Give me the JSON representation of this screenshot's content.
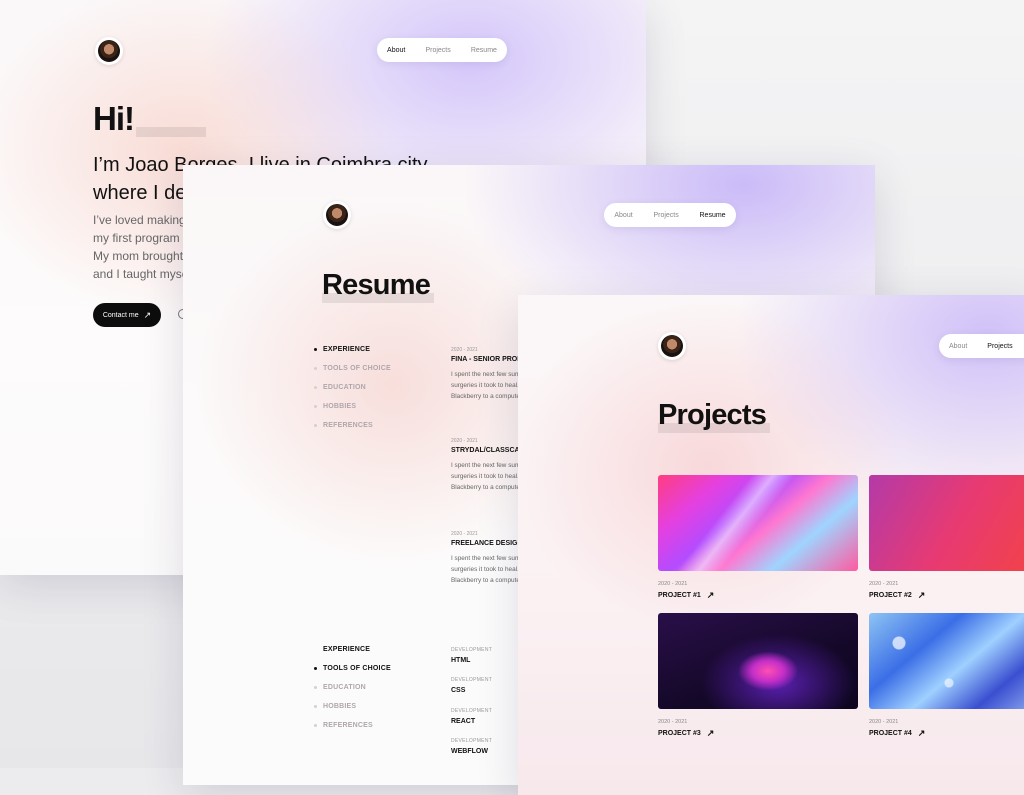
{
  "about_page": {
    "nav": [
      "About",
      "Projects",
      "Resume"
    ],
    "greeting": "Hi!",
    "intro": "I’m Joao Borges. I live in Coimbra city where I design and build things.",
    "body": "I’ve loved making things since I wrote my first program when I was eight. My mom brought home a computer and I taught myself to type.",
    "contact_label": "Contact me",
    "arrow": "↗"
  },
  "resume_page": {
    "nav": [
      "About",
      "Projects",
      "Resume"
    ],
    "title": "Resume",
    "sidebar_top": [
      "EXPERIENCE",
      "TOOLS OF CHOICE",
      "EDUCATION",
      "HOBBIES",
      "REFERENCES"
    ],
    "sidebar_bottom": [
      "EXPERIENCE",
      "TOOLS OF CHOICE",
      "EDUCATION",
      "HOBBIES",
      "REFERENCES"
    ],
    "experience": [
      {
        "date": "2020 - 2021",
        "role": "FINA - SENIOR PRODUCT DESIGNER",
        "desc": "I spent the next few summers and multiple surgeries it took to heal. I sent my dad’s Blackberry to a computer from space."
      },
      {
        "date": "2020 - 2021",
        "role": "STRYDAL/CLASSCARD",
        "desc": "I spent the next few summers and multiple surgeries it took to heal. I sent my dad’s Blackberry to a computer from space."
      },
      {
        "date": "2020 - 2021",
        "role": "FREELANCE DESIGNER",
        "desc": "I spent the next few summers and multiple surgeries it took to heal. I sent my dad’s Blackberry to a computer from space."
      }
    ],
    "tools": [
      {
        "category": "DEVELOPMENT",
        "name": "HTML"
      },
      {
        "category": "DEVELOPMENT",
        "name": "CSS"
      },
      {
        "category": "DEVELOPMENT",
        "name": "REACT"
      },
      {
        "category": "DEVELOPMENT",
        "name": "WEBFLOW"
      }
    ]
  },
  "projects_page": {
    "nav": [
      "About",
      "Projects"
    ],
    "title": "Projects",
    "projects": [
      {
        "date": "2020 - 2021",
        "name": "PROJECT #1"
      },
      {
        "date": "2020 - 2021",
        "name": "PROJECT #2"
      },
      {
        "date": "2020 - 2021",
        "name": "PROJECT #3"
      },
      {
        "date": "2020 - 2021",
        "name": "PROJECT #4"
      }
    ],
    "arrow": "↗"
  }
}
